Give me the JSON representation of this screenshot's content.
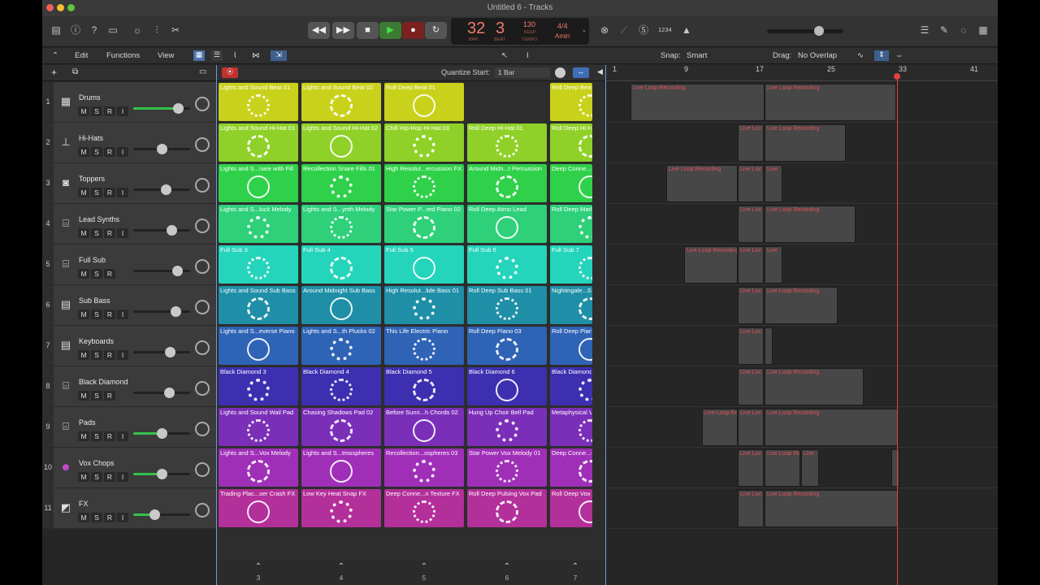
{
  "window": {
    "title": "Untitled 6 - Tracks"
  },
  "lcd": {
    "bar": "32",
    "beat": "3",
    "bar_label": "BAR",
    "beat_label": "BEAT",
    "tempo": "130",
    "keep": "KEEP",
    "tempo_label": "TEMPO",
    "sig": "4/4",
    "key": "Amin"
  },
  "count_in": "1234",
  "menus": {
    "edit": "Edit",
    "functions": "Functions",
    "view": "View"
  },
  "quantize": {
    "label": "Quantize Start:",
    "value": "1 Bar"
  },
  "snap": {
    "label": "Snap:",
    "value": "Smart"
  },
  "drag": {
    "label": "Drag:",
    "value": "No Overlap"
  },
  "ruler": [
    "1",
    "9",
    "17",
    "25",
    "33",
    "41"
  ],
  "tracks": [
    {
      "num": "1",
      "name": "Drums",
      "icon": "drum-machine-icon",
      "r": "R",
      "i": "I"
    },
    {
      "num": "2",
      "name": "Hi-Hats",
      "icon": "hihat-icon",
      "r": "R",
      "i": "I"
    },
    {
      "num": "3",
      "name": "Toppers",
      "icon": "drum-icon",
      "r": "R",
      "i": "I"
    },
    {
      "num": "4",
      "name": "Lead Synths",
      "icon": "synth-icon",
      "r": "R",
      "i": "I"
    },
    {
      "num": "5",
      "name": "Full Sub",
      "icon": "synth-icon",
      "r": "R",
      "i": ""
    },
    {
      "num": "6",
      "name": "Sub Bass",
      "icon": "keyboard-icon",
      "r": "R",
      "i": "I"
    },
    {
      "num": "7",
      "name": "Keyboards",
      "icon": "keyboard-icon",
      "r": "R",
      "i": "I"
    },
    {
      "num": "8",
      "name": "Black Diamond",
      "icon": "synth-icon",
      "r": "R",
      "i": ""
    },
    {
      "num": "9",
      "name": "Pads",
      "icon": "synth-icon",
      "r": "R",
      "i": "I"
    },
    {
      "num": "10",
      "name": "Vox Chops",
      "icon": "vocal-icon",
      "r": "R",
      "i": "I"
    },
    {
      "num": "11",
      "name": "FX",
      "icon": "fx-icon",
      "r": "R",
      "i": "I"
    }
  ],
  "cells": [
    [
      "Lights and Sound Beat 01",
      "Lights and Sound Beat 02",
      "Roll Deep Beat 01",
      "",
      "Roll Deep Beat"
    ],
    [
      "Lights and Sound Hi-Hat 01",
      "Lights and Sound Hi-Hat 02",
      "Chill Hip-Hop Hi-Hat 03",
      "Roll Deep Hi-Hat 01",
      "Roll Deep Hi-Hi"
    ],
    [
      "Lights and S...nare with Fill",
      "Recollection Snare Fills 01",
      "High Resolut...ercussion FX",
      "Around Midn...t Percussion",
      "Deep Conne...e"
    ],
    [
      "Lights and S...luck Melody",
      "Lights and S...ynth Melody",
      "Star Power P...red Piano 02",
      "Roll Deep Atmo Lead",
      "Roll Deep Mark"
    ],
    [
      "Full Sub 3",
      "Full Sub 4",
      "Full Sub 5",
      "Full Sub 6",
      "Full Sub 7"
    ],
    [
      "Lights and Sound Sub Bass",
      "Around Midnight Sub Bass",
      "High Resolut...lide Bass 01",
      "Roll Deep Sub Bass 01",
      "Nightingale...Su"
    ],
    [
      "Lights and S...everse Piano",
      "Lights and S...th Plucks 02",
      "This Life Electric Piano",
      "Roll Deep Piano 03",
      "Roll Deep Piano"
    ],
    [
      "Black Diamond 3",
      "Black Diamond 4",
      "Black Diamond 5",
      "Black Diamond 6",
      "Black Diamond"
    ],
    [
      "Lights and Sound Wail Pad",
      "Chasing Shadows Pad 02",
      "Before Sunri...h Chords 02",
      "Hung Up Choir Bell Pad",
      "Metaphysical Vo"
    ],
    [
      "Lights and S...Vox Melody",
      "Lights and S...tmospheres",
      "Recollection...ospheres 03",
      "Star Power Vox Melody 01",
      "Deep Conne...e"
    ],
    [
      "Trading Plac...ser Crash FX",
      "Low Key Heat Snap FX",
      "Deep Conne...n Texture FX",
      "Roll Deep Pulsing Vox Pad",
      "Roll Deep Vox A"
    ]
  ],
  "row_colors": [
    "#c9d11a",
    "#8fd128",
    "#2fd04a",
    "#2ed07a",
    "#24d4bb",
    "#1e8fa6",
    "#2f63b5",
    "#3d2fb0",
    "#7b2fb8",
    "#a02fb8",
    "#b32f9a"
  ],
  "scenes": [
    "3",
    "4",
    "5",
    "6",
    "7"
  ],
  "region_label": "Live Loop Recording",
  "region_short": "Live Loc",
  "region_tiny": "Live"
}
